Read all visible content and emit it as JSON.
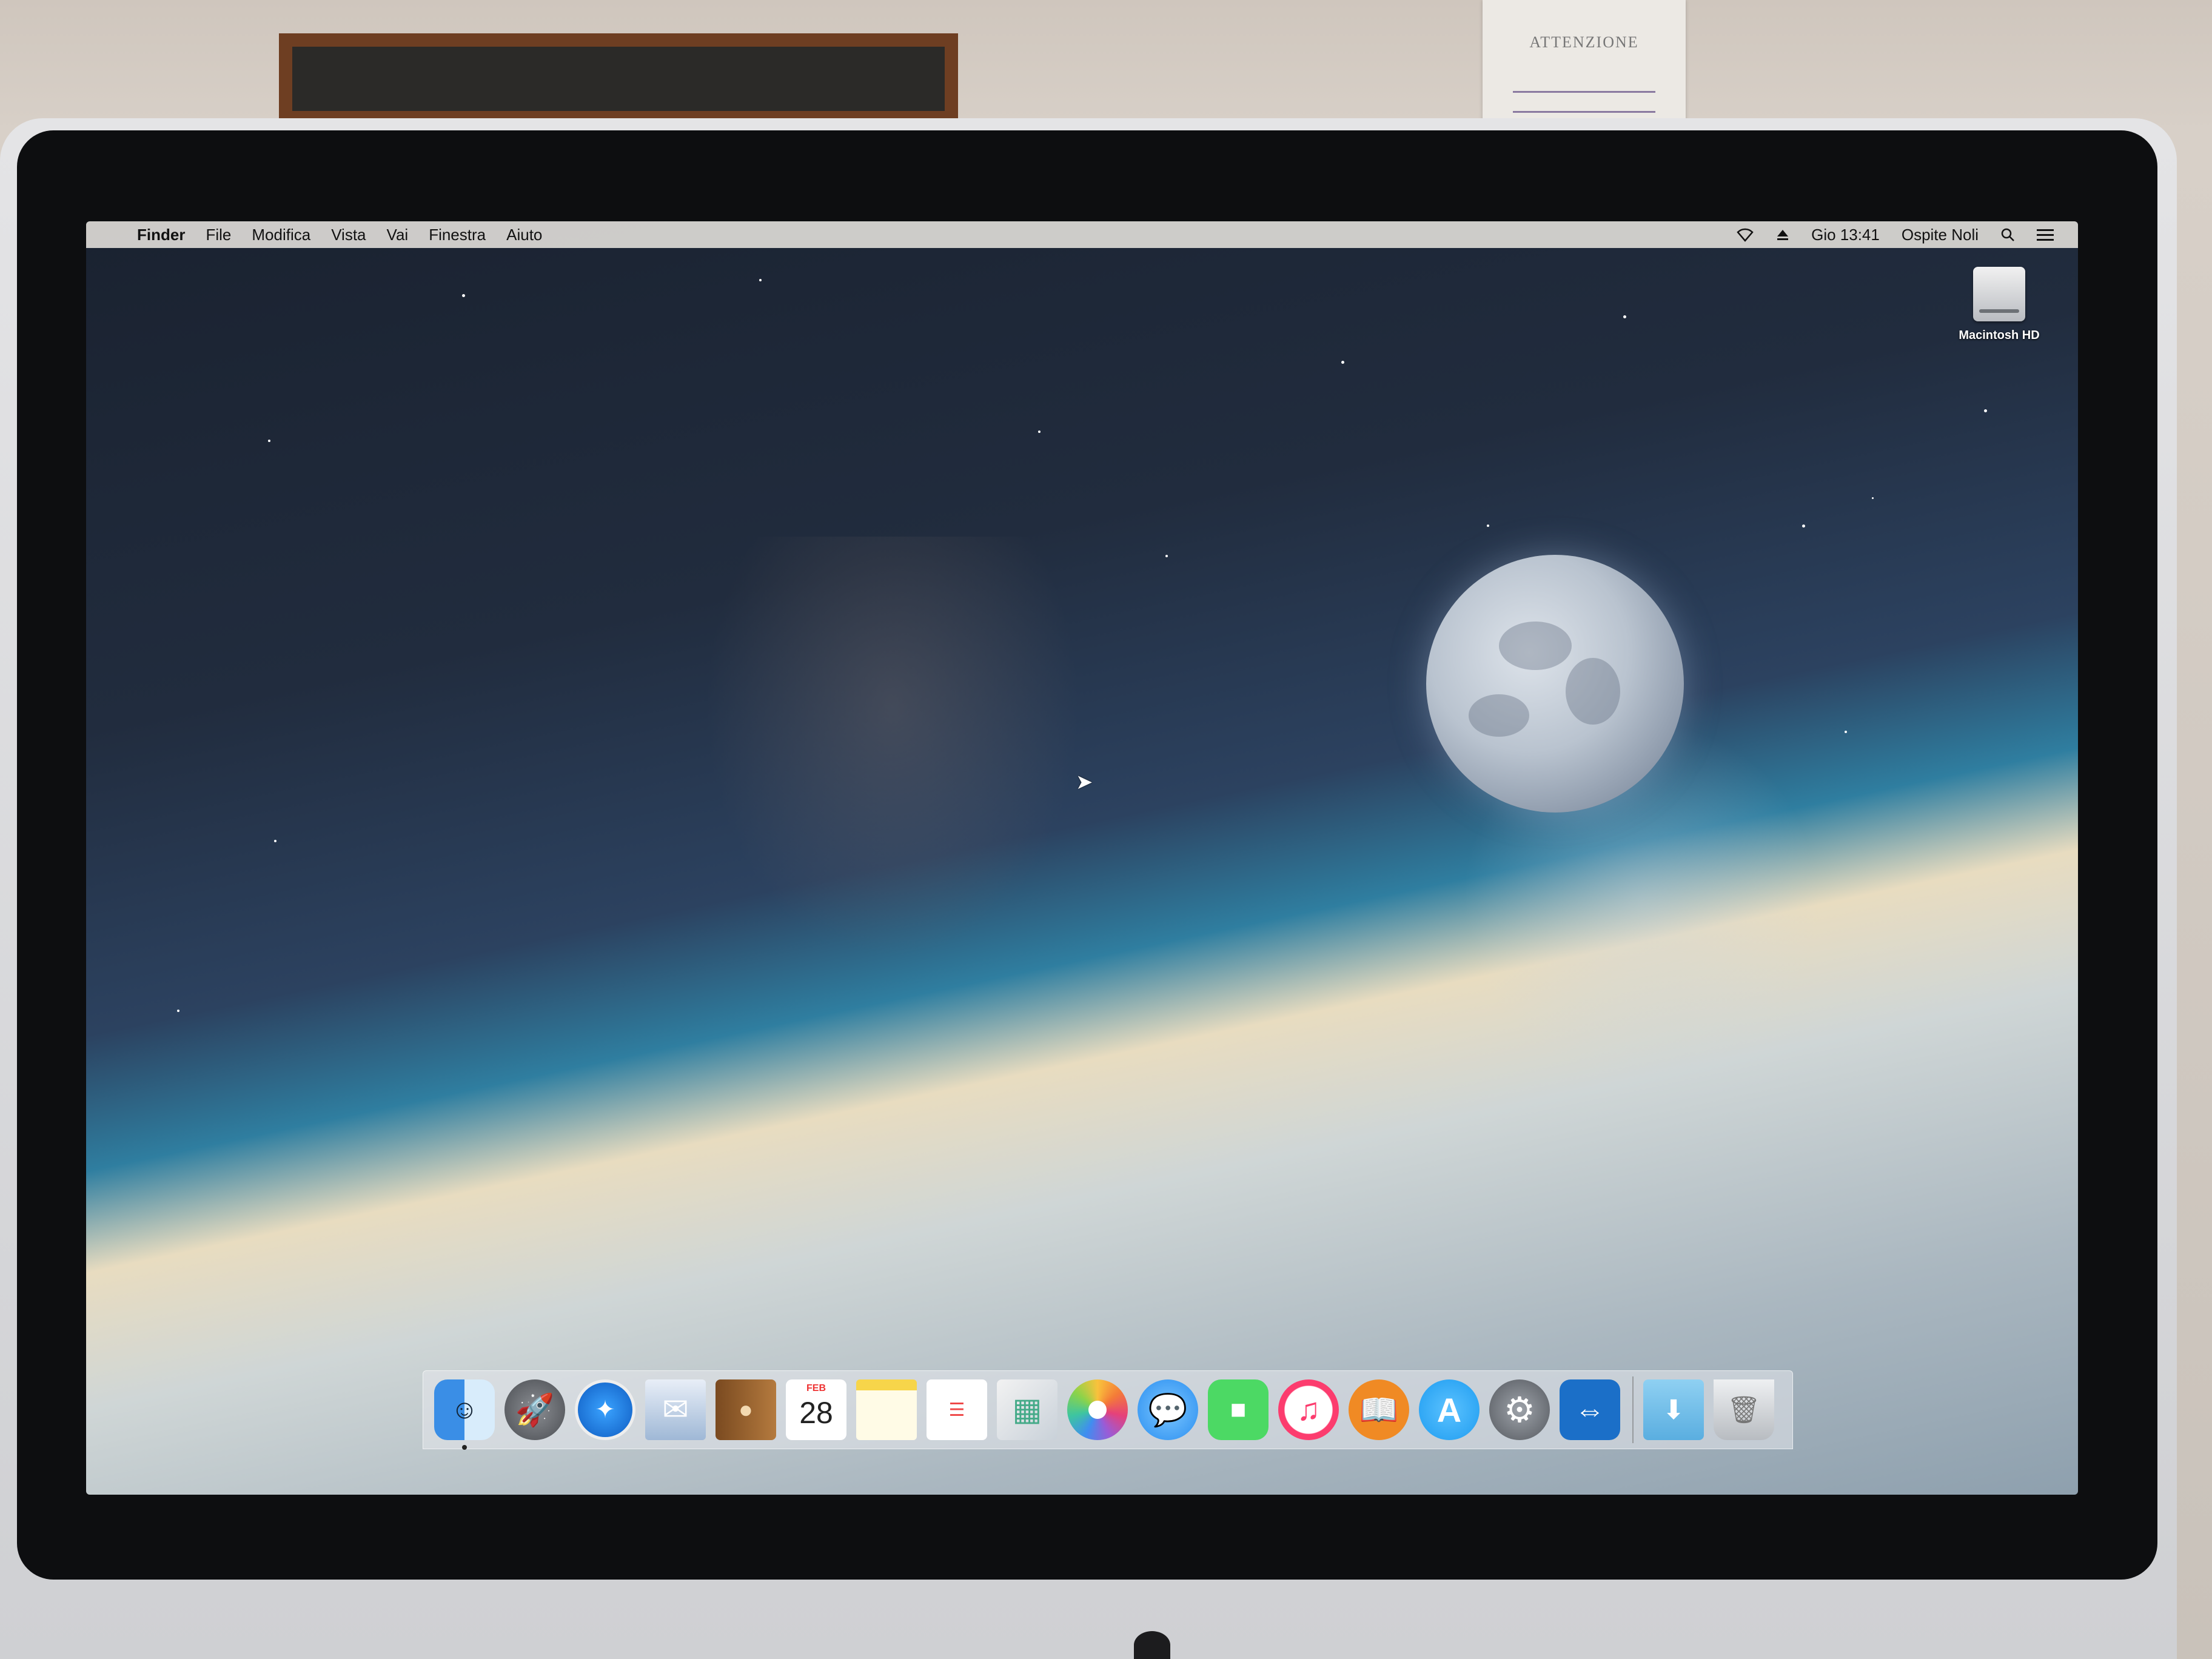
{
  "menubar": {
    "apple_glyph": "",
    "items": [
      "Finder",
      "File",
      "Modifica",
      "Vista",
      "Vai",
      "Finestra",
      "Aiuto"
    ],
    "status": {
      "clock": "Gio 13:41",
      "user": "Ospite Noli"
    }
  },
  "desktop": {
    "hd_label": "Macintosh HD"
  },
  "dock": {
    "calendar_month": "FEB",
    "calendar_day": "28"
  },
  "wall_notice": {
    "title": "ATTENZIONE"
  },
  "colors": {
    "menubar_bg": "#dcdad6",
    "finder_blue": "#3a8ee6",
    "facetime_green": "#4cd964",
    "itunes_pink": "#fc3c6e",
    "ibooks_orange": "#f08a24",
    "appstore_blue": "#1e9cf0",
    "teamviewer_blue": "#1b6fc8"
  }
}
